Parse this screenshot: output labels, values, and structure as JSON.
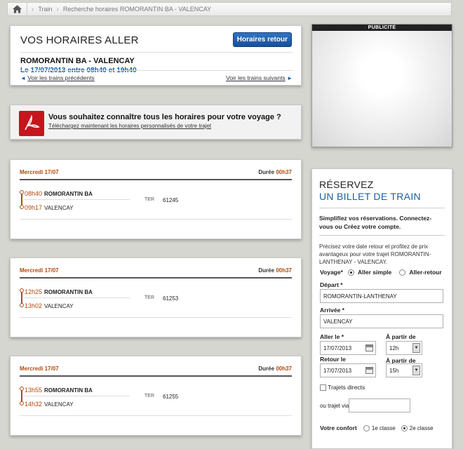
{
  "breadcrumb": {
    "items": [
      "Train",
      "Recherche horaires  ROMORANTIN BA - VALENCAY"
    ]
  },
  "header": {
    "title": "VOS HORAIRES ALLER",
    "return_button": "Horaires retour",
    "route": "ROMORANTIN BA - VALENCAY",
    "date_range": "Le 17/07/2013 entre 08h40 et 19h40",
    "prev_link": "Voir les trains précédents",
    "next_link": "Voir les trains suivants"
  },
  "pdf_banner": {
    "title": "Vous souhaitez connaître tous les horaires pour votre voyage ?",
    "link": "Téléchargez maintenant les horaires personnalisés de votre trajet"
  },
  "ad": {
    "label": "PUBLICITÉ"
  },
  "duration_label": "Durée",
  "trains": [
    {
      "day": "Mercredi 17/07",
      "duration": "00h37",
      "dep_time": "08h40",
      "dep_station": "ROMORANTIN BA",
      "arr_time": "09h17",
      "arr_station": "VALENCAY",
      "type": "TER",
      "number": "61245"
    },
    {
      "day": "Mercredi 17/07",
      "duration": "00h37",
      "dep_time": "12h25",
      "dep_station": "ROMORANTIN BA",
      "arr_time": "13h02",
      "arr_station": "VALENCAY",
      "type": "TER",
      "number": "61253"
    },
    {
      "day": "Mercredi 17/07",
      "duration": "00h37",
      "dep_time": "13h55",
      "dep_station": "ROMORANTIN BA",
      "arr_time": "14h32",
      "arr_station": "VALENCAY",
      "type": "TER",
      "number": "61255"
    }
  ],
  "reservation": {
    "title1": "RÉSERVEZ",
    "title2": "UN BILLET DE TRAIN",
    "intro": "Simplifiez vos réservations. Connectez-vous ou Créez votre compte.",
    "text": "Précisez votre date retour et profitez de prix avantageux pour votre trajet ROMORANTIN-LANTHENAY - VALENCAY.",
    "voyage_label": "Voyage*",
    "aller_simple": "Aller simple",
    "aller_retour": "Aller-retour",
    "depart_label": "Départ *",
    "depart_value": "ROMORANTIN-LANTHENAY",
    "arrivee_label": "Arrivée *",
    "arrivee_value": "VALENCAY",
    "aller_le_label": "Aller le *",
    "aller_date": "17/07/2013",
    "a_partir_label": "À partir de",
    "aller_hour": "12h",
    "retour_label": "Retour le",
    "retour_date": "17/07/2013",
    "retour_hour": "15h",
    "trajets_directs": "Trajets directs",
    "trajet_via_label": "ou trajet via",
    "trajet_via_value": "",
    "confort_label": "Votre confort",
    "classe1": "1e classe",
    "classe2": "2e classe"
  }
}
